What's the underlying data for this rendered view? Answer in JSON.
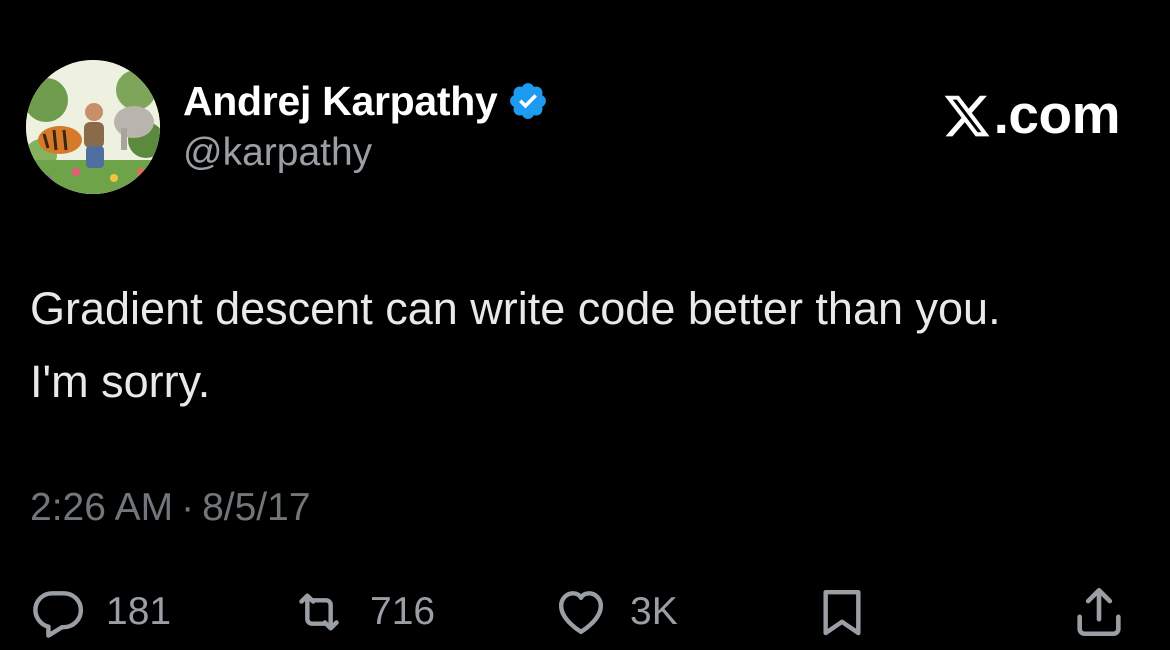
{
  "author": {
    "display_name": "Andrej Karpathy",
    "handle": "@karpathy",
    "verified": true,
    "avatar_icon": "painted-jungle-avatar"
  },
  "site": {
    "label": ".com",
    "logo_icon": "x-logo-icon"
  },
  "tweet": {
    "text": "Gradient descent can write code better than you.\nI'm sorry.",
    "time": "2:26 AM",
    "separator": "·",
    "date": "8/5/17"
  },
  "actions": {
    "reply": {
      "icon": "reply-icon",
      "count": "181"
    },
    "retweet": {
      "icon": "retweet-icon",
      "count": "716"
    },
    "like": {
      "icon": "heart-icon",
      "count": "3K"
    },
    "bookmark": {
      "icon": "bookmark-icon"
    },
    "share": {
      "icon": "share-icon"
    }
  },
  "colors": {
    "background": "#000000",
    "text": "#e7e9ea",
    "secondary_text": "#71767b",
    "verified_blue": "#1d9bf0"
  }
}
